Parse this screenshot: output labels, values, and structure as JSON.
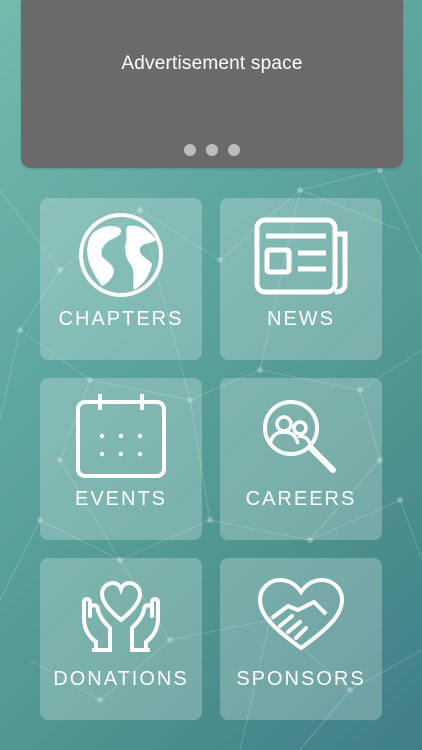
{
  "advertisement": {
    "text": "Advertisement space",
    "pager_dots": 3
  },
  "menu": {
    "chapters": "CHAPTERS",
    "news": "NEWS",
    "events": "EVENTS",
    "careers": "CAREERS",
    "donations": "DONATIONS",
    "sponsors": "SPONSORS"
  },
  "colors": {
    "background_start": "#76b9ad",
    "background_end": "#3f7f86",
    "ad_background": "#6a6a6a",
    "tile_overlay": "rgba(255,255,255,0.24)",
    "text": "#ffffff"
  },
  "icons": [
    "globe-icon",
    "newspaper-icon",
    "calendar-icon",
    "people-search-icon",
    "heart-hands-icon",
    "handshake-heart-icon"
  ]
}
